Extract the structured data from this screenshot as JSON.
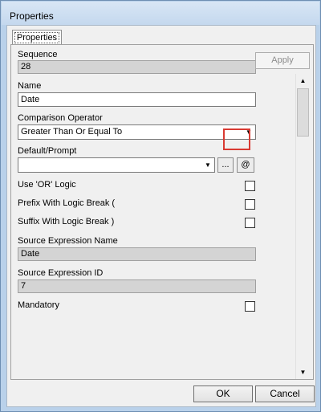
{
  "window": {
    "title": "Properties"
  },
  "tab": {
    "label": "Properties"
  },
  "buttons": {
    "apply": "Apply",
    "ok": "OK",
    "cancel": "Cancel",
    "ellipsis": "...",
    "at": "@"
  },
  "fields": {
    "sequence": {
      "label": "Sequence",
      "value": "28"
    },
    "name": {
      "label": "Name",
      "value": "Date"
    },
    "comparison_operator": {
      "label": "Comparison Operator",
      "value": "Greater Than Or Equal To"
    },
    "default_prompt": {
      "label": "Default/Prompt",
      "value": ""
    },
    "use_or_logic": {
      "label": "Use 'OR' Logic",
      "checked": false
    },
    "prefix_logic_break": {
      "label": "Prefix With Logic Break (",
      "checked": false
    },
    "suffix_logic_break": {
      "label": "Suffix With Logic Break )",
      "checked": false
    },
    "source_expression_name": {
      "label": "Source Expression Name",
      "value": "Date"
    },
    "source_expression_id": {
      "label": "Source Expression ID",
      "value": "7"
    },
    "mandatory": {
      "label": "Mandatory",
      "checked": false
    }
  },
  "colors": {
    "highlight": "#d93a32",
    "readonly_bg": "#d4d4d4",
    "title_bg": "#c4d8ee"
  },
  "icons": {
    "dropdown_arrow": "▼",
    "scroll_up": "▲",
    "scroll_down": "▼"
  }
}
